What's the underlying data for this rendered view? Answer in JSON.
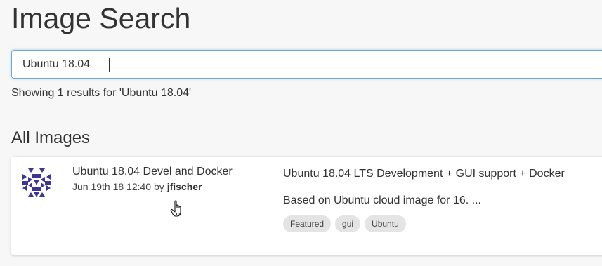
{
  "page": {
    "title": "Image Search"
  },
  "search": {
    "value": "Ubuntu 18.04",
    "result_summary": "Showing 1 results for 'Ubuntu 18.04'"
  },
  "section": {
    "heading": "All Images"
  },
  "results": [
    {
      "name": "Ubuntu 18.04 Devel and Docker",
      "date": "Jun 19th 18 12:40",
      "by_label": "by",
      "author": "jfischer",
      "title": "Ubuntu 18.04 LTS Development + GUI support + Docker",
      "description": "Based on Ubuntu cloud image for 16. ...",
      "tags": [
        "Featured",
        "gui",
        "Ubuntu"
      ],
      "avatar_icon": "identicon-avatar",
      "avatar_color": "#3d3598"
    }
  ],
  "colors": {
    "focus_border": "#6aa6d8",
    "tag_bg": "#e4e4e4",
    "background": "#f7f7f7"
  }
}
